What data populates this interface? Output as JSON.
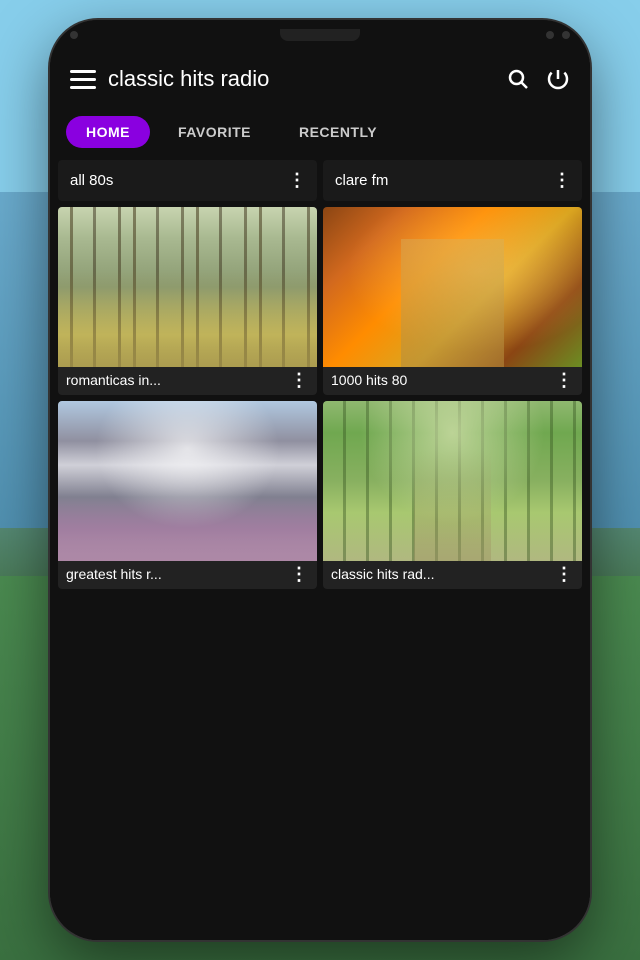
{
  "app": {
    "title": "classic hits radio",
    "colors": {
      "active_tab_bg": "#8a00e0",
      "bg": "#111111",
      "text": "#ffffff"
    }
  },
  "header": {
    "title": "classic hits radio",
    "search_label": "search",
    "power_label": "power"
  },
  "tabs": [
    {
      "id": "home",
      "label": "HOME",
      "active": true
    },
    {
      "id": "favorite",
      "label": "FAVORITE",
      "active": false
    },
    {
      "id": "recently",
      "label": "RECENTLY",
      "active": false
    }
  ],
  "top_row": [
    {
      "label": "all 80s",
      "more": "⋮"
    },
    {
      "label": "clare fm",
      "more": "⋮"
    }
  ],
  "cards": [
    {
      "label": "romanticas in...",
      "img_type": "forest_misty",
      "more": "⋮"
    },
    {
      "label": "1000 hits 80",
      "img_type": "autumn_path",
      "more": "⋮"
    },
    {
      "label": "greatest hits r...",
      "img_type": "mountain",
      "more": "⋮"
    },
    {
      "label": "classic hits rad...",
      "img_type": "forest_path",
      "more": "⋮"
    }
  ]
}
